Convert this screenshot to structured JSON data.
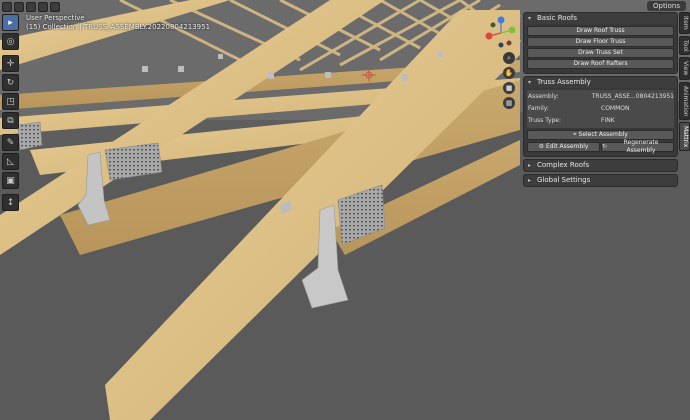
{
  "header": {
    "view_name": "User Perspective",
    "collection": "(15) Collection | TRUSS_ASSEMBLY.20220804213951",
    "options_label": "Options"
  },
  "toolbar": {
    "tools": [
      "cursor-select",
      "cursor",
      "move",
      "rotate",
      "scale",
      "transform",
      "annotate",
      "measure",
      "add-cube",
      "shrink"
    ]
  },
  "gizmo": {
    "x_color": "#e0443c",
    "y_color": "#7fc23a",
    "z_color": "#3c7de0"
  },
  "npanel": {
    "basic_roofs": {
      "title": "Basic Roofs",
      "buttons": [
        "Draw Roof Truss",
        "Draw Floor Truss",
        "Draw Truss Set",
        "Draw Roof Rafters"
      ]
    },
    "truss_assembly": {
      "title": "Truss Assembly",
      "assembly_label": "Assembly:",
      "assembly_value": "TRUSS_ASSE...0804213951",
      "family_label": "Family:",
      "family_value": "COMMON",
      "type_label": "Truss Type:",
      "type_value": "FINK",
      "select_label": "Select Assembly",
      "edit_label": "Edit Assembly",
      "regen_label": "Regenerate Assembly"
    },
    "complex_roofs": {
      "title": "Complex Roofs"
    },
    "global_settings": {
      "title": "Global Settings"
    }
  },
  "sidetabs": [
    "Item",
    "Tool",
    "View",
    "Animation",
    "Mattrix"
  ]
}
